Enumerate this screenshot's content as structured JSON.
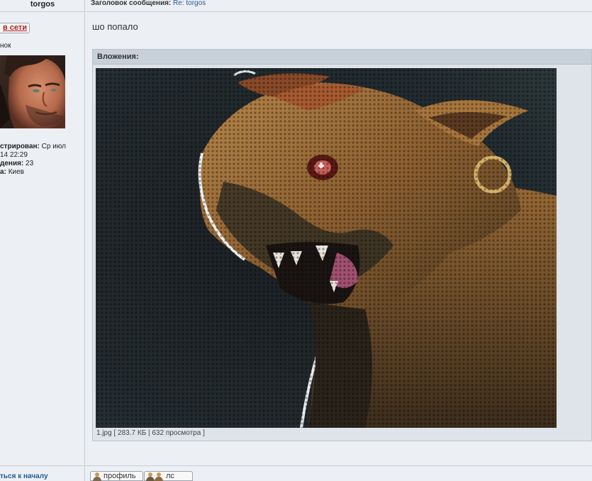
{
  "user": {
    "username": "torgos",
    "status_button": "в сети",
    "rank": "нок",
    "registered_label": "стрирован:",
    "registered_value": "Ср июл",
    "registered_value2": "14 22:29",
    "posts_label": "дения:",
    "posts_value": "23",
    "location_label": "а:",
    "location_value": "Киев"
  },
  "post": {
    "subject_label": "Заголовок сообщения:",
    "subject_value": "Re: torgos",
    "body": "шо попало"
  },
  "attachment": {
    "title": "Вложения:",
    "caption": "1.jpg [ 283.7 КБ | 632 просмотра ]"
  },
  "footer": {
    "back_to_top": "ться к началу",
    "profile_button": "профиль",
    "pm_button": "лс"
  }
}
